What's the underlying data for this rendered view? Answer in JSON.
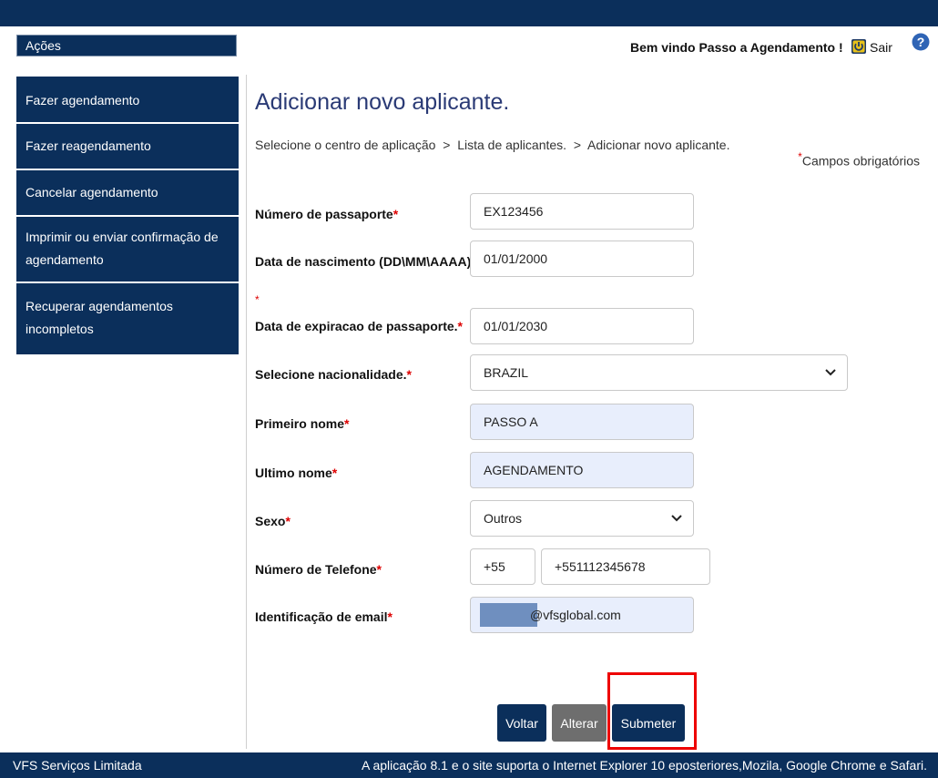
{
  "header": {
    "welcome": "Bem vindo Passo a Agendamento !",
    "logout_label": "Sair",
    "help_label": "?"
  },
  "sidebar": {
    "title": "Ações",
    "items": [
      {
        "label": "Fazer agendamento"
      },
      {
        "label": "Fazer reagendamento"
      },
      {
        "label": "Cancelar agendamento"
      },
      {
        "label": "Imprimir ou enviar confirmação de agendamento"
      },
      {
        "label": "Recuperar agendamentos incompletos"
      }
    ]
  },
  "main": {
    "title": "Adicionar novo aplicante.",
    "breadcrumb": "Selecione o centro de aplicação  >  Lista de aplicantes.  >  Adicionar novo aplicante.",
    "required_note": "Campos obrigatórios",
    "required_mark": "*"
  },
  "form": {
    "passport_number": {
      "label": "Número de passaporte",
      "value": "EX123456"
    },
    "birth_date": {
      "label": "Data de nascimento (DD\\MM\\AAAA)",
      "value": "01/01/2000"
    },
    "passport_expiry": {
      "label": "Data de expiracao de passaporte.",
      "value": "01/01/2030"
    },
    "nationality": {
      "label": "Selecione nacionalidade.",
      "value": "BRAZIL"
    },
    "first_name": {
      "label": "Primeiro nome",
      "value": "PASSO A"
    },
    "last_name": {
      "label": "Ultimo nome",
      "value": "AGENDAMENTO"
    },
    "gender": {
      "label": "Sexo",
      "value": "Outros"
    },
    "phone": {
      "label": "Número de Telefone",
      "country_code": "+55",
      "number": "+551112345678"
    },
    "email": {
      "label": "Identificação de email",
      "domain": "@vfsglobal.com"
    }
  },
  "buttons": {
    "back": "Voltar",
    "edit": "Alterar",
    "submit": "Submeter"
  },
  "footer": {
    "company": "VFS Serviços Limitada",
    "support_note": "A aplicação 8.1 e o site suporta o Internet Explorer 10 eposteriores,Mozila, Google Chrome e Safari."
  },
  "colors": {
    "navy": "#0b2f5b",
    "title_blue": "#2a3a75",
    "required_red": "#dd0000",
    "disabled_gray": "#6e6e6e",
    "highlight_red": "#ee0000"
  }
}
